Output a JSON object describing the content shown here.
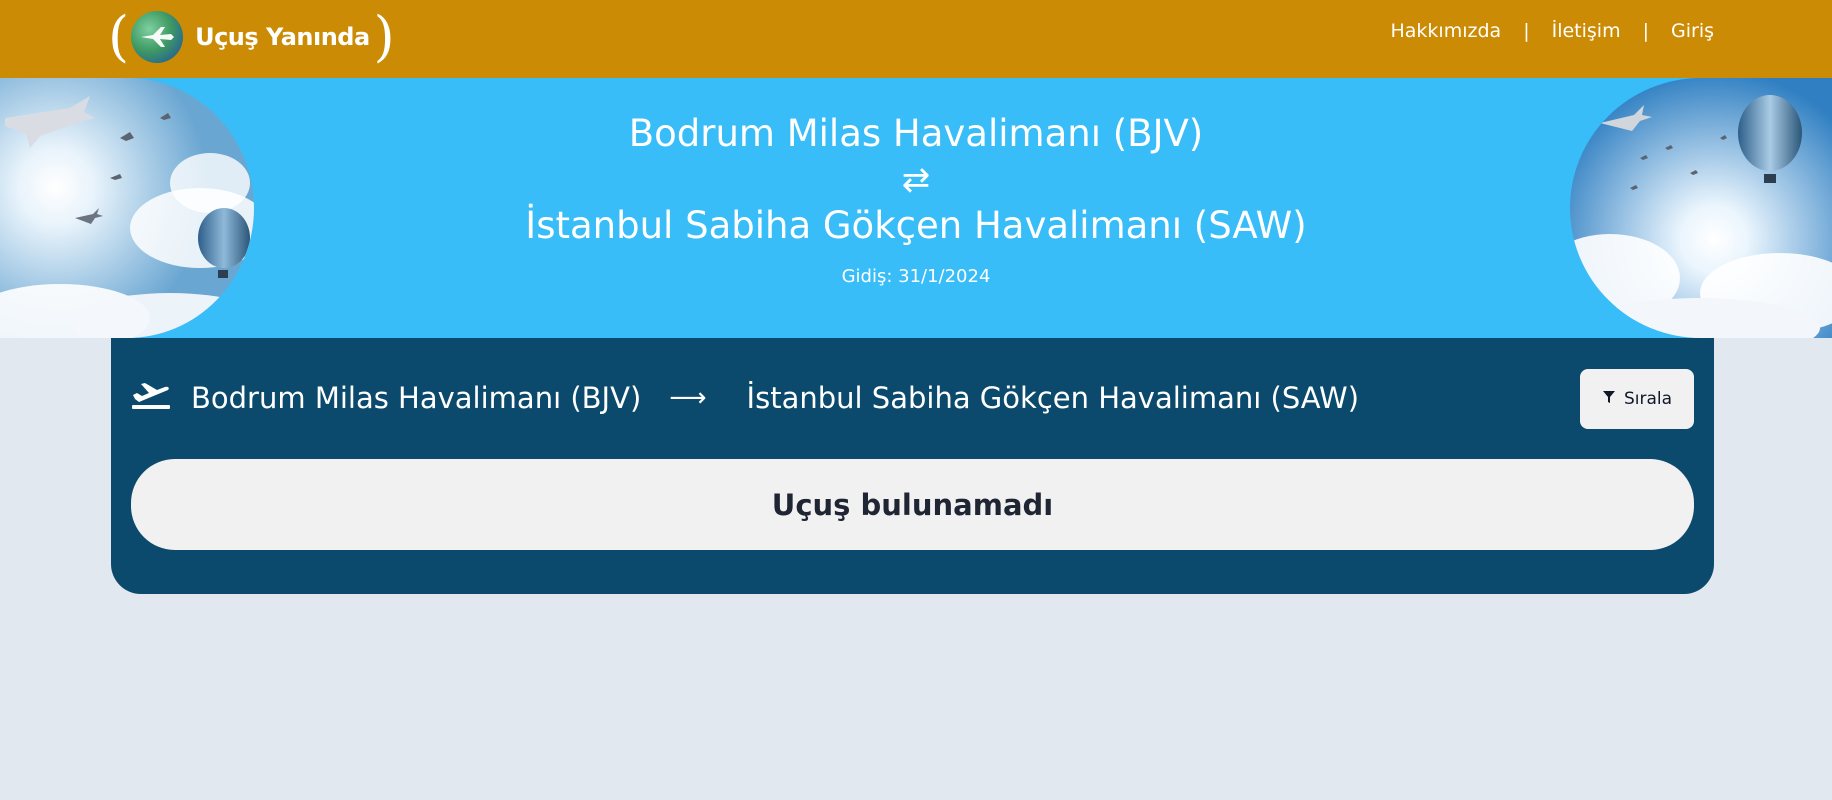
{
  "header": {
    "brand": "Uçuş Yanında",
    "logo_icon": "globe-plane-icon",
    "nav": [
      {
        "label": "Hakkımızda"
      },
      {
        "label": "İletişim"
      },
      {
        "label": "Giriş"
      }
    ],
    "separator": "|",
    "colors": {
      "background": "#cc8b04",
      "text": "#ffffff"
    }
  },
  "hero": {
    "from": "Bodrum Milas Havalimanı (BJV)",
    "swap_icon": "⇄",
    "to": "İstanbul Sabiha Gökçen Havalimanı (SAW)",
    "date": "Gidiş: 31/1/2024",
    "colors": {
      "background": "#38bdf8"
    }
  },
  "results": {
    "route_from": "Bodrum Milas Havalimanı (BJV)",
    "route_arrow": "⟶",
    "route_to": "İstanbul Sabiha Gökçen Havalimanı (SAW)",
    "sort_label": "Sırala",
    "sort_icon": "filter-icon",
    "empty_message": "Uçuş bulunamadı",
    "colors": {
      "card": "#0b4a6c",
      "panel": "#f1f1f2"
    }
  },
  "page": {
    "background": "#e2e8f0"
  }
}
